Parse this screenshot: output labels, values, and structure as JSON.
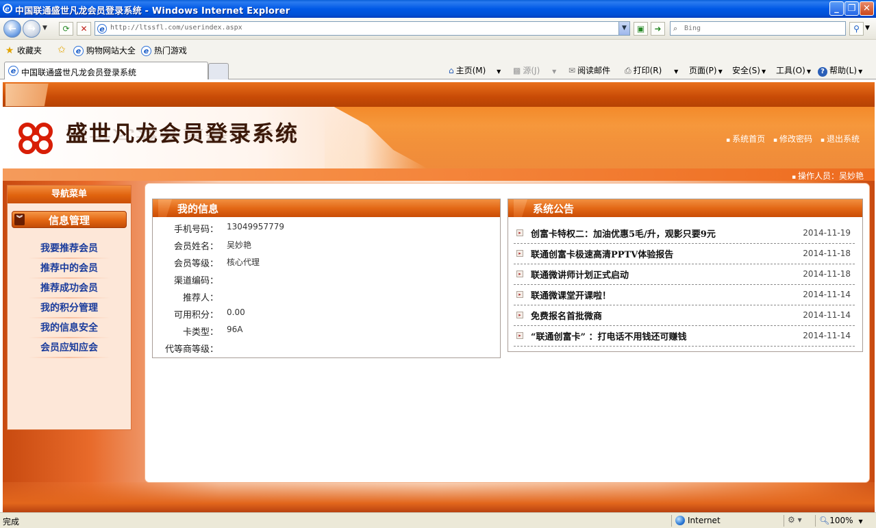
{
  "window": {
    "title": "中国联通盛世凡龙会员登录系统 - Windows Internet Explorer"
  },
  "address_bar": {
    "url": "http://ltssfl.com/userindex.aspx",
    "search_placeholder": "Bing"
  },
  "favorites_bar": {
    "favorites_label": "收藏夹",
    "links": [
      "购物网站大全",
      "热门游戏"
    ]
  },
  "tabs": [
    {
      "label": "中国联通盛世凡龙会员登录系统",
      "active": true
    }
  ],
  "command_bar": {
    "home": "主页(M)",
    "feeds": "源(J)",
    "read_mail": "阅读邮件",
    "print": "打印(R)",
    "page": "页面(P)",
    "safety": "安全(S)",
    "tools": "工具(O)",
    "help": "帮助(L)"
  },
  "site": {
    "title": "盛世凡龙会员登录系统",
    "top_links": [
      "系统首页",
      "修改密码",
      "退出系统"
    ],
    "operator_label": "操作人员：",
    "operator_name": "吴妙艳"
  },
  "sidebar": {
    "header": "导航菜单",
    "section": "信息管理",
    "items": [
      "我要推荐会员",
      "推荐中的会员",
      "推荐成功会员",
      "我的积分管理",
      "我的信息安全",
      "会员应知应会"
    ]
  },
  "my_info": {
    "title": "我的信息",
    "rows": [
      {
        "label": "手机号码：",
        "value": "13049957779"
      },
      {
        "label": "会员姓名：",
        "value": "吴妙艳"
      },
      {
        "label": "会员等级：",
        "value": "核心代理"
      },
      {
        "label": "渠道编码：",
        "value": ""
      },
      {
        "label": "推荐人：",
        "value": ""
      },
      {
        "label": "可用积分：",
        "value": "0.00"
      },
      {
        "label": "卡类型：",
        "value": "96A"
      },
      {
        "label": "代等商等级：",
        "value": ""
      }
    ]
  },
  "notices": {
    "title": "系统公告",
    "items": [
      {
        "title": "创富卡特权二：加油优惠5毛/升，观影只要9元",
        "date": "2014-11-19"
      },
      {
        "title": "联通创富卡极速高清PPTV体验报告",
        "date": "2014-11-18"
      },
      {
        "title": "联通微讲师计划正式启动",
        "date": "2014-11-18"
      },
      {
        "title": "联通微课堂开课啦！",
        "date": "2014-11-14"
      },
      {
        "title": "免费报名首批微商",
        "date": "2014-11-14"
      },
      {
        "title": "“联通创富卡” ：打电话不用钱还可赚钱",
        "date": "2014-11-14"
      }
    ]
  },
  "status_bar": {
    "status": "完成",
    "zone": "Internet",
    "zoom": "100%"
  },
  "colors": {
    "brand_orange": "#e36612",
    "link_blue": "#1a3c9c",
    "ie_title_blue": "#0058e6"
  }
}
